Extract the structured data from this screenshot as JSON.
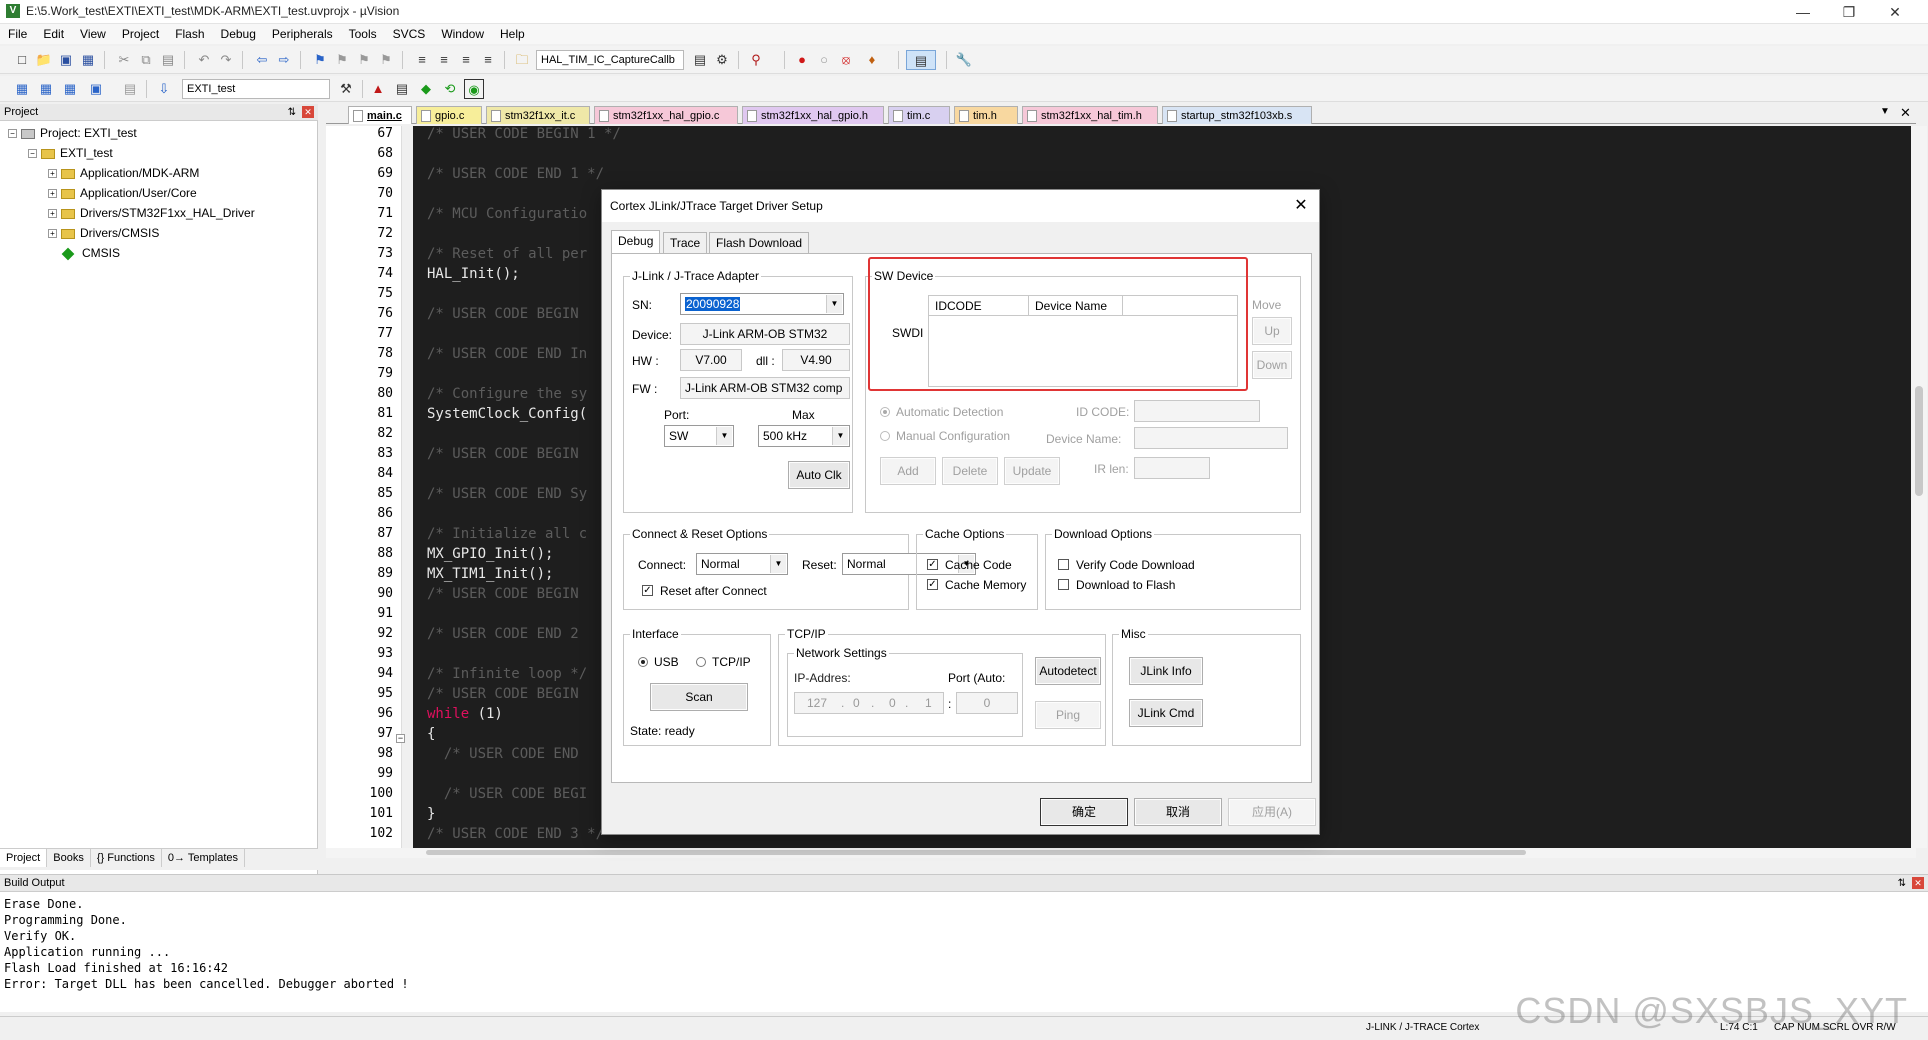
{
  "window": {
    "title": "E:\\5.Work_test\\EXTI\\EXTI_test\\MDK-ARM\\EXTI_test.uvprojx - µVision"
  },
  "menu": [
    "File",
    "Edit",
    "View",
    "Project",
    "Flash",
    "Debug",
    "Peripherals",
    "Tools",
    "SVCS",
    "Window",
    "Help"
  ],
  "toolbar": {
    "function_combo": "HAL_TIM_IC_CaptureCallb",
    "target_combo": "EXTI_test"
  },
  "project_panel": {
    "header": "Project",
    "root": "Project: EXTI_test",
    "target": "EXTI_test",
    "groups": [
      "Application/MDK-ARM",
      "Application/User/Core",
      "Drivers/STM32F1xx_HAL_Driver",
      "Drivers/CMSIS",
      "CMSIS"
    ],
    "tabs": [
      "Project",
      "Books",
      "{} Functions",
      "0→ Templates"
    ]
  },
  "file_tabs": [
    "main.c",
    "gpio.c",
    "stm32f1xx_it.c",
    "stm32f1xx_hal_gpio.c",
    "stm32f1xx_hal_gpio.h",
    "tim.c",
    "tim.h",
    "stm32f1xx_hal_tim.h",
    "startup_stm32f103xb.s"
  ],
  "line_numbers": [
    "67",
    "68",
    "69",
    "70",
    "71",
    "72",
    "73",
    "74",
    "75",
    "76",
    "77",
    "78",
    "79",
    "80",
    "81",
    "82",
    "83",
    "84",
    "85",
    "86",
    "87",
    "88",
    "89",
    "90",
    "91",
    "92",
    "93",
    "94",
    "95",
    "96",
    "97",
    "98",
    "99",
    "100",
    "101",
    "102"
  ],
  "code_lines": [
    "/* USER CODE BEGIN 1 */",
    "",
    "/* USER CODE END 1 */",
    "",
    "/* MCU Configuratio",
    "",
    "/* Reset of all per",
    "HAL_Init();",
    "",
    "/* USER CODE BEGIN",
    "",
    "/* USER CODE END In",
    "",
    "/* Configure the sy",
    "SystemClock_Config(",
    "",
    "/* USER CODE BEGIN",
    "",
    "/* USER CODE END Sy",
    "",
    "/* Initialize all c",
    "MX_GPIO_Init();",
    "MX_TIM1_Init();",
    "/* USER CODE BEGIN",
    "",
    "/* USER CODE END 2",
    "",
    "/* Infinite loop */",
    "/* USER CODE BEGIN",
    "while (1)",
    "{",
    "  /* USER CODE END",
    "",
    "  /* USER CODE BEGI",
    "}",
    "/* USER CODE END 3 */"
  ],
  "dialog": {
    "title": "Cortex JLink/JTrace Target Driver Setup",
    "tabs": [
      "Debug",
      "Trace",
      "Flash Download"
    ],
    "adapter": {
      "title": "J-Link / J-Trace Adapter",
      "sn_label": "SN:",
      "sn_value": "20090928",
      "device_label": "Device:",
      "device_value": "J-Link ARM-OB STM32",
      "hw_label": "HW :",
      "hw_value": "V7.00",
      "dll_label": "dll :",
      "dll_value": "V4.90",
      "fw_label": "FW :",
      "fw_value": "J-Link ARM-OB STM32 comp",
      "port_label": "Port:",
      "port_value": "SW",
      "max_label": "Max",
      "max_value": "500 kHz",
      "autoclk": "Auto Clk"
    },
    "sw_device": {
      "title": "SW Device",
      "swdi_label": "SWDI",
      "col_idcode": "IDCODE",
      "col_device_name": "Device Name",
      "move_label": "Move",
      "up": "Up",
      "down": "Down",
      "auto_detect": "Automatic Detection",
      "manual_config": "Manual Configuration",
      "id_code_label": "ID CODE:",
      "device_name_label": "Device Name:",
      "ir_len_label": "IR len:",
      "add": "Add",
      "delete": "Delete",
      "update": "Update"
    },
    "connect_reset": {
      "title": "Connect & Reset Options",
      "connect_label": "Connect:",
      "connect_value": "Normal",
      "reset_label": "Reset:",
      "reset_value": "Normal",
      "reset_after_connect": "Reset after Connect"
    },
    "cache": {
      "title": "Cache Options",
      "cache_code": "Cache Code",
      "cache_memory": "Cache Memory"
    },
    "download": {
      "title": "Download Options",
      "verify": "Verify Code Download",
      "to_flash": "Download to Flash"
    },
    "interface": {
      "title": "Interface",
      "usb": "USB",
      "tcpip": "TCP/IP",
      "scan": "Scan",
      "state": "State: ready"
    },
    "tcpip": {
      "title": "TCP/IP",
      "network_title": "Network Settings",
      "ip_label": "IP-Addres:",
      "port_label": "Port (Auto:",
      "ip": [
        "127",
        "0",
        "0",
        "1"
      ],
      "port": "0",
      "autodetect": "Autodetect",
      "ping": "Ping"
    },
    "misc": {
      "title": "Misc",
      "jlink_info": "JLink Info",
      "jlink_cmd": "JLink Cmd"
    },
    "ok": "确定",
    "cancel": "取消",
    "apply": "应用(A)"
  },
  "build_output": {
    "header": "Build Output",
    "lines": [
      "Erase Done.",
      "Programming Done.",
      "Verify OK.",
      "Application running ...",
      "Flash Load finished at 16:16:42",
      "Error: Target DLL has been cancelled. Debugger aborted !"
    ]
  },
  "status": {
    "debugger": "J-LINK / J-TRACE Cortex",
    "position": "L:74 C:1",
    "flags": "CAP  NUM  SCRL  OVR  R/W"
  },
  "watermark": "CSDN @SXSBJS_XYT",
  "colors": {
    "editor_bg": "#1e1e1e",
    "comment": "#5c5c5c",
    "keyword": "#e0105e",
    "highlight_box": "#e03535",
    "selection": "#0a62d0"
  }
}
